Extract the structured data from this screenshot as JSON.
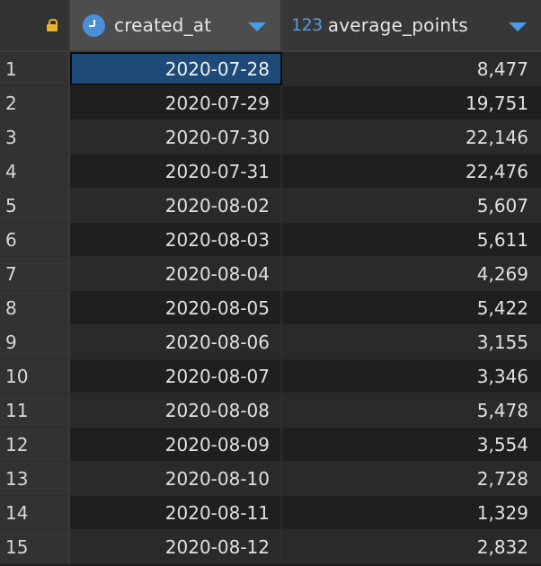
{
  "header": {
    "created_at_label": "created_at",
    "average_points_type": "123",
    "average_points_label": "average_points"
  },
  "colors": {
    "selected_cell": "#1e4a7a",
    "accent": "#4a9be6",
    "lock": "#e8b32a"
  },
  "rows": [
    {
      "num": "1",
      "created_at": "2020-07-28",
      "average_points": "8,477"
    },
    {
      "num": "2",
      "created_at": "2020-07-29",
      "average_points": "19,751"
    },
    {
      "num": "3",
      "created_at": "2020-07-30",
      "average_points": "22,146"
    },
    {
      "num": "4",
      "created_at": "2020-07-31",
      "average_points": "22,476"
    },
    {
      "num": "5",
      "created_at": "2020-08-02",
      "average_points": "5,607"
    },
    {
      "num": "6",
      "created_at": "2020-08-03",
      "average_points": "5,611"
    },
    {
      "num": "7",
      "created_at": "2020-08-04",
      "average_points": "4,269"
    },
    {
      "num": "8",
      "created_at": "2020-08-05",
      "average_points": "5,422"
    },
    {
      "num": "9",
      "created_at": "2020-08-06",
      "average_points": "3,155"
    },
    {
      "num": "10",
      "created_at": "2020-08-07",
      "average_points": "3,346"
    },
    {
      "num": "11",
      "created_at": "2020-08-08",
      "average_points": "5,478"
    },
    {
      "num": "12",
      "created_at": "2020-08-09",
      "average_points": "3,554"
    },
    {
      "num": "13",
      "created_at": "2020-08-10",
      "average_points": "2,728"
    },
    {
      "num": "14",
      "created_at": "2020-08-11",
      "average_points": "1,329"
    },
    {
      "num": "15",
      "created_at": "2020-08-12",
      "average_points": "2,832"
    }
  ]
}
